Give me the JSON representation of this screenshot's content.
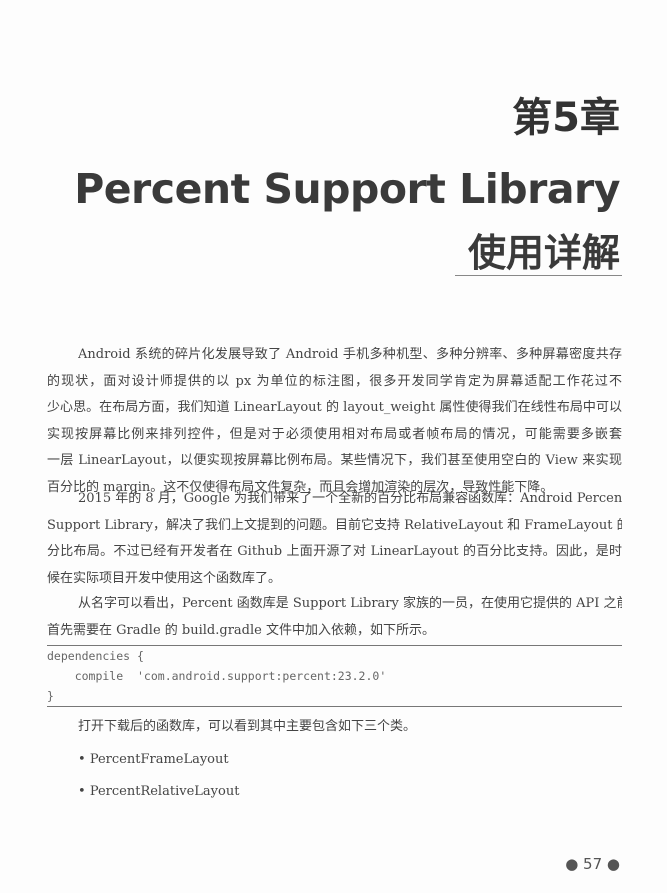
{
  "chapter": "第5章",
  "title_en": "Percent Support Library",
  "title_cn": "使用详解",
  "paragraphs": [
    [
      "Android 系统的碎片化发展导致了 Android 手机多种机型、多种分辨率、多种屏幕密度共存",
      "的现状，面对设计师提供的以 px 为单位的标注图，很多开发同学肯定为屏幕适配工作花过不",
      "少心思。在布局方面，我们知道 LinearLayout 的 layout_weight 属性使得我们在线性布局中可以",
      "实现按屏幕比例来排列控件，但是对于必须使用相对布局或者帧布局的情况，可能需要多嵌套",
      "一层 LinearLayout，以便实现按屏幕比例布局。某些情况下，我们甚至使用空白的 View 来实现",
      "百分比的 margin。这不仅使得布局文件复杂，而且会增加渲染的层次，导致性能下降。"
    ],
    [
      "2015 年的 8 月，Google 为我们带来了一个全新的百分比布局兼容函数库：Android Percent",
      "Support Library，解决了我们上文提到的问题。目前它支持 RelativeLayout 和 FrameLayout 的百",
      "分比布局。不过已经有开发者在 Github 上面开源了对 LinearLayout 的百分比支持。因此，是时",
      "候在实际项目开发中使用这个函数库了。"
    ],
    [
      "从名字可以看出，Percent 函数库是 Support Library 家族的一员，在使用它提供的 API 之前，",
      "首先需要在 Gradle 的 build.gradle 文件中加入依赖，如下所示。"
    ]
  ],
  "code": [
    "dependencies {",
    "    compile  'com.android.support:percent:23.2.0'",
    "}"
  ],
  "after_code": "打开下载后的函数库，可以看到其中主要包含如下三个类。",
  "bullets": [
    "PercentFrameLayout",
    "PercentRelativeLayout"
  ],
  "page_number": "57"
}
